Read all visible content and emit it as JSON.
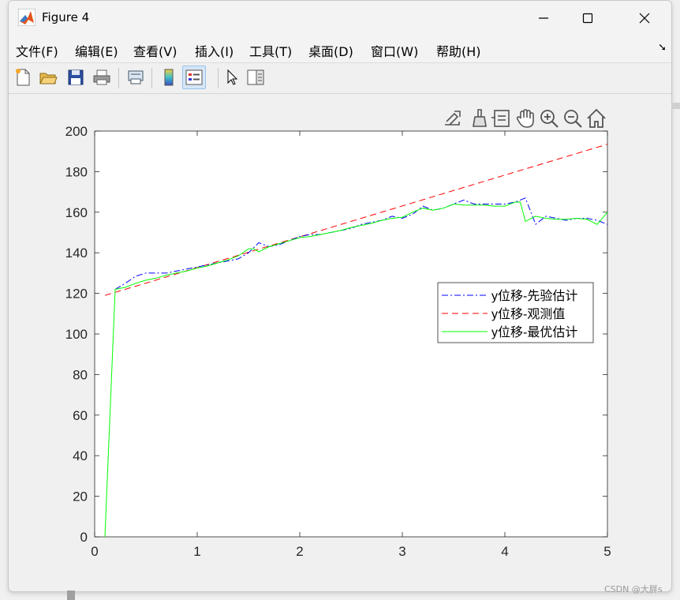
{
  "window": {
    "title": "Figure 4",
    "controls": [
      "minimize",
      "maximize",
      "close"
    ]
  },
  "menu": {
    "items": [
      "文件(F)",
      "编辑(E)",
      "查看(V)",
      "插入(I)",
      "工具(T)",
      "桌面(D)",
      "窗口(W)",
      "帮助(H)"
    ]
  },
  "toolbar": {
    "buttons": [
      "new-figure-icon",
      "open-file-icon",
      "save-icon",
      "print-icon",
      "link-print-icon",
      "colorbar-icon",
      "legend-icon",
      "pointer-icon",
      "property-editor-icon"
    ]
  },
  "axes_toolbar": [
    "export-icon",
    "brush-icon",
    "data-tips-icon",
    "pan-icon",
    "zoom-in-icon",
    "zoom-out-icon",
    "home-icon"
  ],
  "watermark": "CSDN @大胖s",
  "chart_data": {
    "type": "line",
    "xlim": [
      0,
      5
    ],
    "ylim": [
      0,
      200
    ],
    "xticks": [
      0,
      1,
      2,
      3,
      4,
      5
    ],
    "yticks": [
      0,
      20,
      40,
      60,
      80,
      100,
      120,
      140,
      160,
      180,
      200
    ],
    "xtick_labels": [
      "0",
      "1",
      "2",
      "3",
      "4",
      "5"
    ],
    "ytick_labels": [
      "0",
      "20",
      "40",
      "60",
      "80",
      "100",
      "120",
      "140",
      "160",
      "180",
      "200"
    ],
    "grid": false,
    "legend_position": "east",
    "series": [
      {
        "name": "y位移-先验估计",
        "color": "#0000ff",
        "style": "dashdot",
        "x": [
          0.2,
          0.3,
          0.4,
          0.5,
          0.6,
          0.7,
          0.8,
          0.9,
          1.0,
          1.1,
          1.2,
          1.3,
          1.4,
          1.5,
          1.6,
          1.7,
          1.8,
          1.9,
          2.0,
          2.1,
          2.2,
          2.3,
          2.4,
          2.5,
          2.6,
          2.7,
          2.8,
          2.9,
          3.0,
          3.1,
          3.2,
          3.3,
          3.4,
          3.5,
          3.6,
          3.7,
          3.8,
          3.9,
          4.0,
          4.1,
          4.2,
          4.3,
          4.4,
          4.5,
          4.6,
          4.7,
          4.8,
          4.9,
          5.0
        ],
        "y": [
          122,
          125,
          128.5,
          130,
          130,
          130,
          131,
          132,
          133,
          134,
          135,
          136,
          137,
          140,
          145,
          143,
          144,
          146,
          148,
          149,
          149,
          150,
          151,
          152,
          154,
          155,
          156,
          158,
          157,
          159,
          163,
          161,
          162,
          164,
          166,
          164,
          164,
          164,
          164,
          165,
          167,
          154,
          158,
          157,
          156,
          157,
          157,
          156,
          154
        ]
      },
      {
        "name": "y位移-观测值",
        "color": "#ff0000",
        "style": "dashed",
        "x": [
          0.1,
          5.0
        ],
        "y": [
          119,
          193.5
        ]
      },
      {
        "name": "y位移-最优估计",
        "color": "#00ff00",
        "style": "solid",
        "x": [
          0.1,
          0.2,
          0.3,
          0.4,
          0.5,
          0.6,
          0.7,
          0.8,
          0.9,
          1.0,
          1.1,
          1.2,
          1.3,
          1.4,
          1.5,
          1.55,
          1.6,
          1.7,
          1.8,
          1.9,
          2.0,
          2.1,
          2.2,
          2.3,
          2.4,
          2.5,
          2.6,
          2.7,
          2.8,
          2.9,
          3.0,
          3.1,
          3.2,
          3.3,
          3.4,
          3.5,
          3.6,
          3.7,
          3.8,
          3.9,
          4.0,
          4.1,
          4.15,
          4.2,
          4.3,
          4.4,
          4.5,
          4.6,
          4.7,
          4.8,
          4.9,
          5.0
        ],
        "y": [
          0,
          122,
          123,
          125,
          126.5,
          127.5,
          129,
          130,
          131,
          132.5,
          133.5,
          135,
          136.5,
          138.5,
          142,
          142,
          140.5,
          143,
          144.5,
          146,
          147.5,
          148,
          149,
          150,
          151,
          152.5,
          153.5,
          154.5,
          156,
          157,
          157.5,
          160,
          162,
          161,
          162,
          164,
          163.5,
          163.5,
          163.5,
          163,
          163,
          165,
          165,
          155.5,
          158,
          157,
          156.5,
          156.5,
          157,
          156.5,
          154,
          160
        ]
      }
    ]
  }
}
